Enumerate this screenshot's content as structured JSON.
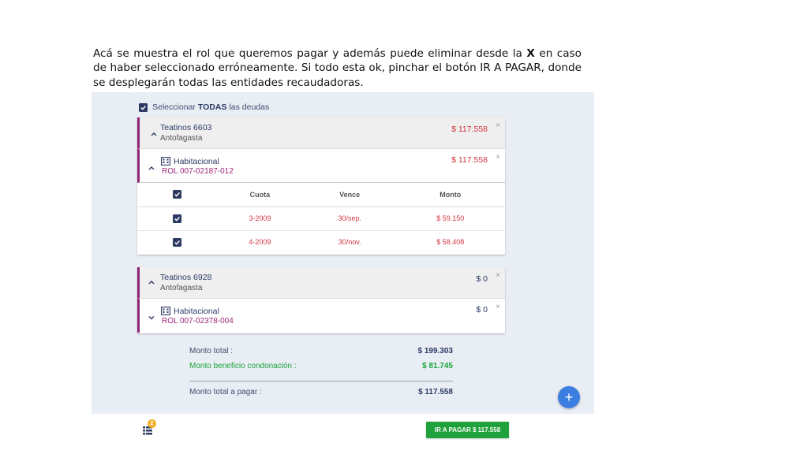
{
  "intro": {
    "part1": "Acá se muestra el rol que queremos pagar y además puede eliminar desde la ",
    "bold": "X",
    "part2": " en caso de haber seleccionado erróneamente. Si todo esta ok, pinchar el botón IR A PAGAR, donde se desplegarán todas las entidades recaudadoras."
  },
  "select_all": {
    "prefix": "Seleccionar",
    "bold": "TODAS",
    "suffix": "las deudas",
    "checked": true
  },
  "groups": [
    {
      "name": "Teatinos 6603",
      "city": "Antofagasta",
      "amount": "$ 117.558",
      "close": "×",
      "expanded": true,
      "property": {
        "type": "Habitacional",
        "rol": "ROL 007-02187-012",
        "amount": "$ 117.558",
        "close": "×",
        "expanded": true
      },
      "table": {
        "headers": [
          "Cuota",
          "Vence",
          "Monto"
        ],
        "rows": [
          {
            "cuota": "3-2009",
            "vence": "30/sep.",
            "monto": "$ 59.150"
          },
          {
            "cuota": "4-2009",
            "vence": "30/nov.",
            "monto": "$ 58.408"
          }
        ]
      }
    },
    {
      "name": "Teatinos 6928",
      "city": "Antofagasta",
      "amount": "$ 0",
      "close": "×",
      "expanded": true,
      "property": {
        "type": "Habitacional",
        "rol": "ROL 007-02378-004",
        "amount": "$ 0",
        "close": "×",
        "expanded": false
      }
    }
  ],
  "totals": {
    "total_label": "Monto total :",
    "total_value": "$ 199.303",
    "benefit_label": "Monto beneficio condonación :",
    "benefit_value": "$ 81.745",
    "pay_label": "Monto total a pagar :",
    "pay_value": "$ 117.558"
  },
  "fab": {
    "label": "+"
  },
  "cart": {
    "badge": "2",
    "icon": "cart-list-icon"
  },
  "pay_button": {
    "label": "IR A PAGAR $ 117.558"
  },
  "colors": {
    "accent": "#8e2472",
    "navy": "#2c3a63",
    "red": "#d13540",
    "green": "#1fa13b",
    "blue": "#3b7de0",
    "badge": "#f3b12b"
  }
}
